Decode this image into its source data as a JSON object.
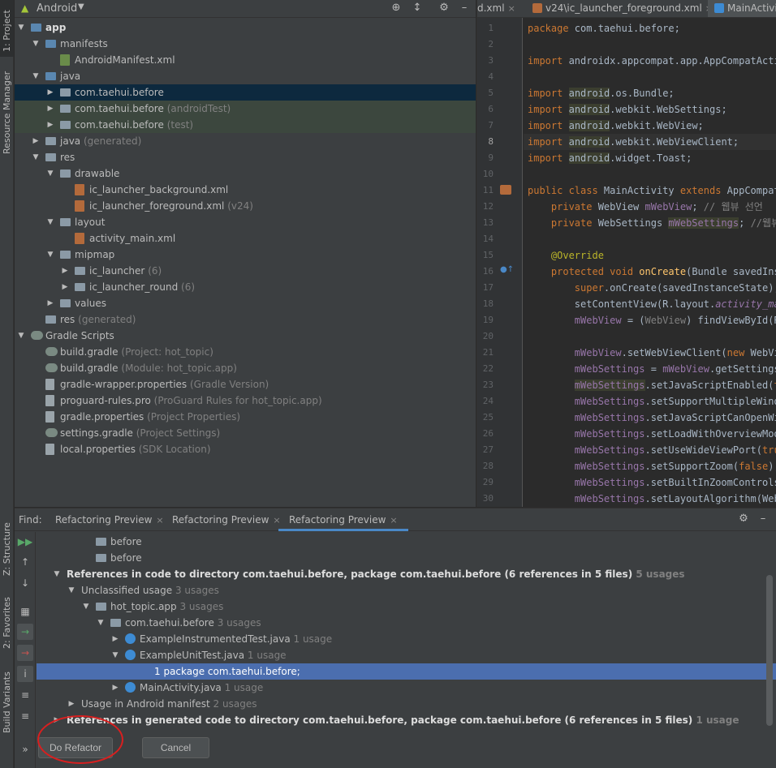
{
  "side_tabs": {
    "project": "1: Project",
    "resource_manager": "Resource Manager",
    "structure": "Z: Structure",
    "favorites": "2: Favorites",
    "build_variants": "Build Variants"
  },
  "project_panel": {
    "view_label": "Android",
    "tree": [
      {
        "label": "app",
        "hint": "",
        "icon": "folder-blue",
        "arrow": "down",
        "depth": 0,
        "bold": true
      },
      {
        "label": "manifests",
        "hint": "",
        "icon": "folder-blue",
        "arrow": "down",
        "depth": 1
      },
      {
        "label": "AndroidManifest.xml",
        "hint": "",
        "icon": "manifest",
        "arrow": "",
        "depth": 2
      },
      {
        "label": "java",
        "hint": "",
        "icon": "folder-blue",
        "arrow": "down",
        "depth": 1
      },
      {
        "label": "com.taehui.before",
        "hint": "",
        "icon": "pkg",
        "arrow": "right",
        "depth": 2,
        "state": "selected"
      },
      {
        "label": "com.taehui.before",
        "hint": "(androidTest)",
        "icon": "pkg",
        "arrow": "right",
        "depth": 2,
        "state": "scope"
      },
      {
        "label": "com.taehui.before",
        "hint": "(test)",
        "icon": "pkg",
        "arrow": "right",
        "depth": 2,
        "state": "scope"
      },
      {
        "label": "java",
        "hint": "(generated)",
        "icon": "folder",
        "arrow": "right",
        "depth": 1
      },
      {
        "label": "res",
        "hint": "",
        "icon": "folder",
        "arrow": "down",
        "depth": 1
      },
      {
        "label": "drawable",
        "hint": "",
        "icon": "folder",
        "arrow": "down",
        "depth": 2
      },
      {
        "label": "ic_launcher_background.xml",
        "hint": "",
        "icon": "xml",
        "arrow": "",
        "depth": 3
      },
      {
        "label": "ic_launcher_foreground.xml",
        "hint": "(v24)",
        "icon": "xml",
        "arrow": "",
        "depth": 3
      },
      {
        "label": "layout",
        "hint": "",
        "icon": "folder",
        "arrow": "down",
        "depth": 2
      },
      {
        "label": "activity_main.xml",
        "hint": "",
        "icon": "xml",
        "arrow": "",
        "depth": 3
      },
      {
        "label": "mipmap",
        "hint": "",
        "icon": "folder",
        "arrow": "down",
        "depth": 2
      },
      {
        "label": "ic_launcher",
        "hint": "(6)",
        "icon": "folder",
        "arrow": "right",
        "depth": 3
      },
      {
        "label": "ic_launcher_round",
        "hint": "(6)",
        "icon": "folder",
        "arrow": "right",
        "depth": 3
      },
      {
        "label": "values",
        "hint": "",
        "icon": "folder",
        "arrow": "right",
        "depth": 2
      },
      {
        "label": "res",
        "hint": "(generated)",
        "icon": "folder",
        "arrow": "",
        "depth": 1
      },
      {
        "label": "Gradle Scripts",
        "hint": "",
        "icon": "gradle",
        "arrow": "down",
        "depth": 0
      },
      {
        "label": "build.gradle",
        "hint": "(Project: hot_topic)",
        "icon": "gradle",
        "arrow": "",
        "depth": 1
      },
      {
        "label": "build.gradle",
        "hint": "(Module: hot_topic.app)",
        "icon": "gradle",
        "arrow": "",
        "depth": 1
      },
      {
        "label": "gradle-wrapper.properties",
        "hint": "(Gradle Version)",
        "icon": "props",
        "arrow": "",
        "depth": 1
      },
      {
        "label": "proguard-rules.pro",
        "hint": "(ProGuard Rules for hot_topic.app)",
        "icon": "props",
        "arrow": "",
        "depth": 1
      },
      {
        "label": "gradle.properties",
        "hint": "(Project Properties)",
        "icon": "props",
        "arrow": "",
        "depth": 1
      },
      {
        "label": "settings.gradle",
        "hint": "(Project Settings)",
        "icon": "gradle",
        "arrow": "",
        "depth": 1
      },
      {
        "label": "local.properties",
        "hint": "(SDK Location)",
        "icon": "props",
        "arrow": "",
        "depth": 1
      }
    ]
  },
  "editor": {
    "tabs": [
      {
        "label": "d.xml",
        "icon": "",
        "active": false
      },
      {
        "label": "v24\\ic_launcher_foreground.xml",
        "icon": "xml",
        "active": false
      },
      {
        "label": "MainActivity",
        "icon": "class",
        "active": true
      }
    ],
    "current_line": 8,
    "lines": [
      {
        "n": 1,
        "html": "<span class='kw'>package</span> com.taehui.before;"
      },
      {
        "n": 2,
        "html": ""
      },
      {
        "n": 3,
        "html": "<span class='kw'>import</span> androidx.appcompat.app.AppCompatActiv"
      },
      {
        "n": 4,
        "html": ""
      },
      {
        "n": 5,
        "html": "<span class='kw'>import</span> <span class='hlbg'>android</span>.os.Bundle;"
      },
      {
        "n": 6,
        "html": "<span class='kw'>import</span> <span class='hlbg'>android</span>.webkit.WebSettings;"
      },
      {
        "n": 7,
        "html": "<span class='kw'>import</span> <span class='hlbg'>android</span>.webkit.WebView;"
      },
      {
        "n": 8,
        "html": "<span class='kw'>import</span> <span class='hlbg'>android</span>.webkit.WebViewClient;"
      },
      {
        "n": 9,
        "html": "<span class='kw'>import</span> <span class='hlbg'>android</span>.widget.Toast;"
      },
      {
        "n": 10,
        "html": ""
      },
      {
        "n": 11,
        "html": "<span class='kw'>public class</span> MainActivity <span class='kw'>extends</span> AppCompatA"
      },
      {
        "n": 12,
        "html": "    <span class='kw'>private</span> WebView <span class='fld'>mWebView</span>; <span class='cmt'>// 웹뷰 선언</span>"
      },
      {
        "n": 13,
        "html": "    <span class='kw'>private</span> WebSettings <span class='fld hlbg'>mWebSettings</span>; <span class='cmt'>//웹뷰</span>"
      },
      {
        "n": 14,
        "html": ""
      },
      {
        "n": 15,
        "html": "    <span class='ann'>@Override</span>"
      },
      {
        "n": 16,
        "html": "    <span class='kw'>protected void</span> <span class='fn'>onCreate</span>(Bundle savedInst"
      },
      {
        "n": 17,
        "html": "        <span class='kw'>super</span>.onCreate(savedInstanceState);"
      },
      {
        "n": 18,
        "html": "        setContentView(R.layout.<span class='fld it'>activity_mai</span>"
      },
      {
        "n": 19,
        "html": "        <span class='fld'>mWebView</span> = (<span class='cmt'>WebView</span>) findViewById(R."
      },
      {
        "n": 20,
        "html": ""
      },
      {
        "n": 21,
        "html": "        <span class='fld'>mWebView</span>.setWebViewClient(<span class='kw'>new</span> WebVie"
      },
      {
        "n": 22,
        "html": "        <span class='fld'>mWebSettings</span> = <span class='fld'>mWebView</span>.getSettings("
      },
      {
        "n": 23,
        "html": "        <span class='fld hlbg'>mWebSettings</span>.setJavaScriptEnabled(<span class='kw'>tr</span>"
      },
      {
        "n": 24,
        "html": "        <span class='fld'>mWebSettings</span>.setSupportMultipleWindo"
      },
      {
        "n": 25,
        "html": "        <span class='fld'>mWebSettings</span>.setJavaScriptCanOpenWin"
      },
      {
        "n": 26,
        "html": "        <span class='fld'>mWebSettings</span>.setLoadWithOverviewMode"
      },
      {
        "n": 27,
        "html": "        <span class='fld'>mWebSettings</span>.setUseWideViewPort(<span class='kw'>true</span>"
      },
      {
        "n": 28,
        "html": "        <span class='fld'>mWebSettings</span>.setSupportZoom(<span class='kw'>false</span>);"
      },
      {
        "n": 29,
        "html": "        <span class='fld'>mWebSettings</span>.setBuiltInZoomControls("
      },
      {
        "n": 30,
        "html": "        <span class='fld'>mWebSettings</span>.setLayoutAlgorithm(WebS"
      }
    ]
  },
  "bottom_panel": {
    "find_label": "Find:",
    "tabs": [
      {
        "label": "Refactoring Preview",
        "active": false
      },
      {
        "label": "Refactoring Preview",
        "active": false
      },
      {
        "label": "Refactoring Preview",
        "active": true
      }
    ],
    "results": [
      {
        "depth": 2,
        "arrow": "",
        "icon": "pkg",
        "label": "before",
        "count": "",
        "kind": "plain"
      },
      {
        "depth": 2,
        "arrow": "",
        "icon": "pkg",
        "label": "before",
        "count": "",
        "kind": "plain"
      },
      {
        "depth": 2,
        "arrow": "",
        "icon": "pkg",
        "label": "before",
        "count": "",
        "kind": "plain"
      },
      {
        "depth": 0,
        "arrow": "down",
        "icon": "",
        "label": "References in code to directory com.taehui.before, package com.taehui.before (6 references in 5 files)",
        "count": "5 usages",
        "kind": "head"
      },
      {
        "depth": 1,
        "arrow": "down",
        "icon": "",
        "label": "Unclassified usage",
        "count": "3 usages",
        "kind": "plain"
      },
      {
        "depth": 2,
        "arrow": "down",
        "icon": "pkg",
        "label": "hot_topic.app",
        "count": "3 usages",
        "kind": "plain"
      },
      {
        "depth": 3,
        "arrow": "down",
        "icon": "pkg",
        "label": "com.taehui.before",
        "count": "3 usages",
        "kind": "plain"
      },
      {
        "depth": 4,
        "arrow": "right",
        "icon": "java",
        "label": "ExampleInstrumentedTest.java",
        "count": "1 usage",
        "kind": "plain"
      },
      {
        "depth": 4,
        "arrow": "down",
        "icon": "java",
        "label": "ExampleUnitTest.java",
        "count": "1 usage",
        "kind": "plain"
      },
      {
        "depth": 6,
        "arrow": "",
        "icon": "",
        "label": "1 package com.taehui.before;",
        "count": "",
        "kind": "selected"
      },
      {
        "depth": 4,
        "arrow": "right",
        "icon": "java",
        "label": "MainActivity.java",
        "count": "1 usage",
        "kind": "plain"
      },
      {
        "depth": 1,
        "arrow": "right",
        "icon": "",
        "label": "Usage in Android manifest",
        "count": "2 usages",
        "kind": "plain"
      },
      {
        "depth": 0,
        "arrow": "right",
        "icon": "",
        "label": "References in generated code to directory com.taehui.before, package com.taehui.before (6 references in 5 files)",
        "count": "1 usage",
        "kind": "head"
      }
    ],
    "do_refactor_label": "Do Refactor",
    "cancel_label": "Cancel"
  },
  "annotation_color": "#d91f1f"
}
